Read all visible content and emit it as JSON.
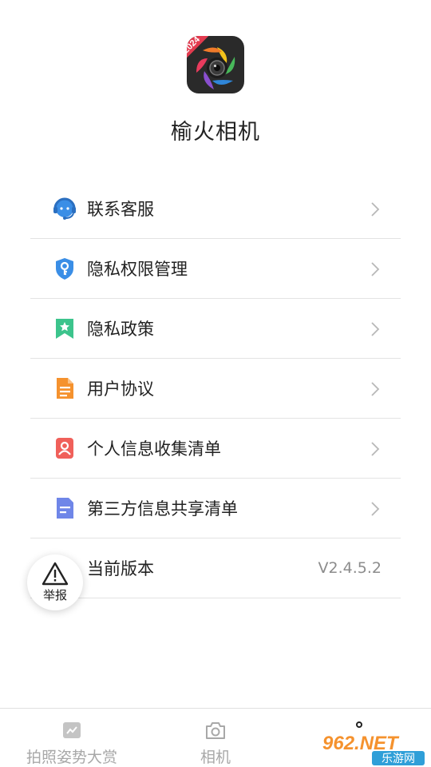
{
  "app": {
    "name": "榆火相机",
    "logo_badge": "2024"
  },
  "menu": {
    "items": [
      {
        "label": "联系客服",
        "icon": "customer-service-icon"
      },
      {
        "label": "隐私权限管理",
        "icon": "shield-key-icon"
      },
      {
        "label": "隐私政策",
        "icon": "bookmark-star-icon"
      },
      {
        "label": "用户协议",
        "icon": "document-icon"
      },
      {
        "label": "个人信息收集清单",
        "icon": "person-card-icon"
      },
      {
        "label": "第三方信息共享清单",
        "icon": "file-list-icon"
      }
    ],
    "version_label": "当前版本",
    "version_value": "V2.4.5.2"
  },
  "report": {
    "label": "举报",
    "icon": "warning-triangle-icon"
  },
  "tabbar": {
    "tabs": [
      {
        "label": "拍照姿势大赏",
        "icon": "photo-pose-icon"
      },
      {
        "label": "相机",
        "icon": "camera-icon"
      },
      {
        "label": "",
        "icon": "profile-icon"
      }
    ]
  },
  "watermark": {
    "text": "962.NET",
    "subtext": "乐游网"
  },
  "colors": {
    "text": "#222222",
    "muted": "#8c8c8c",
    "divider": "#e3e3e3",
    "tab_inactive": "#a8a8a8",
    "icon_blue": "#3a8ee6",
    "icon_green": "#3cc48c",
    "icon_orange": "#f5922e",
    "icon_red": "#f0605a",
    "icon_indigo": "#6f86e8"
  }
}
